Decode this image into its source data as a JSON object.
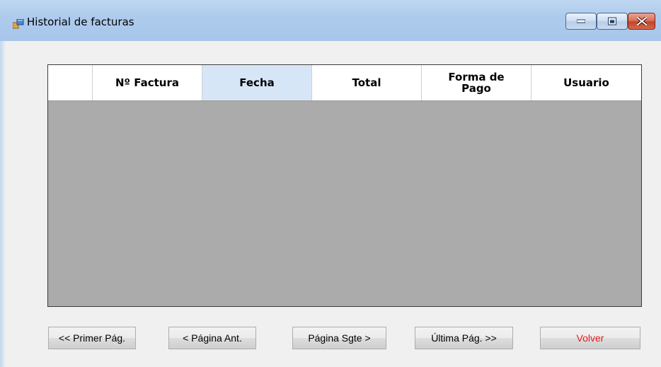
{
  "window": {
    "title": "Historial de facturas",
    "icon": "form-icon",
    "caption_buttons": [
      "minimize-icon",
      "maximize-icon",
      "close-icon"
    ]
  },
  "grid": {
    "columns": [
      "Nº Factura",
      "Fecha",
      "Total",
      "Forma de Pago",
      "Usuario"
    ],
    "selected_column": "Fecha",
    "rows": []
  },
  "buttons": {
    "first": "<< Primer Pág.",
    "prev": "< Página Ant.",
    "next": "Página Sgte >",
    "last": "Última Pág. >>",
    "back": "Volver"
  },
  "colors": {
    "back_button_text": "#e81c1c",
    "grid_empty_area": "#ababab",
    "selected_header": "#d7e6f7"
  }
}
